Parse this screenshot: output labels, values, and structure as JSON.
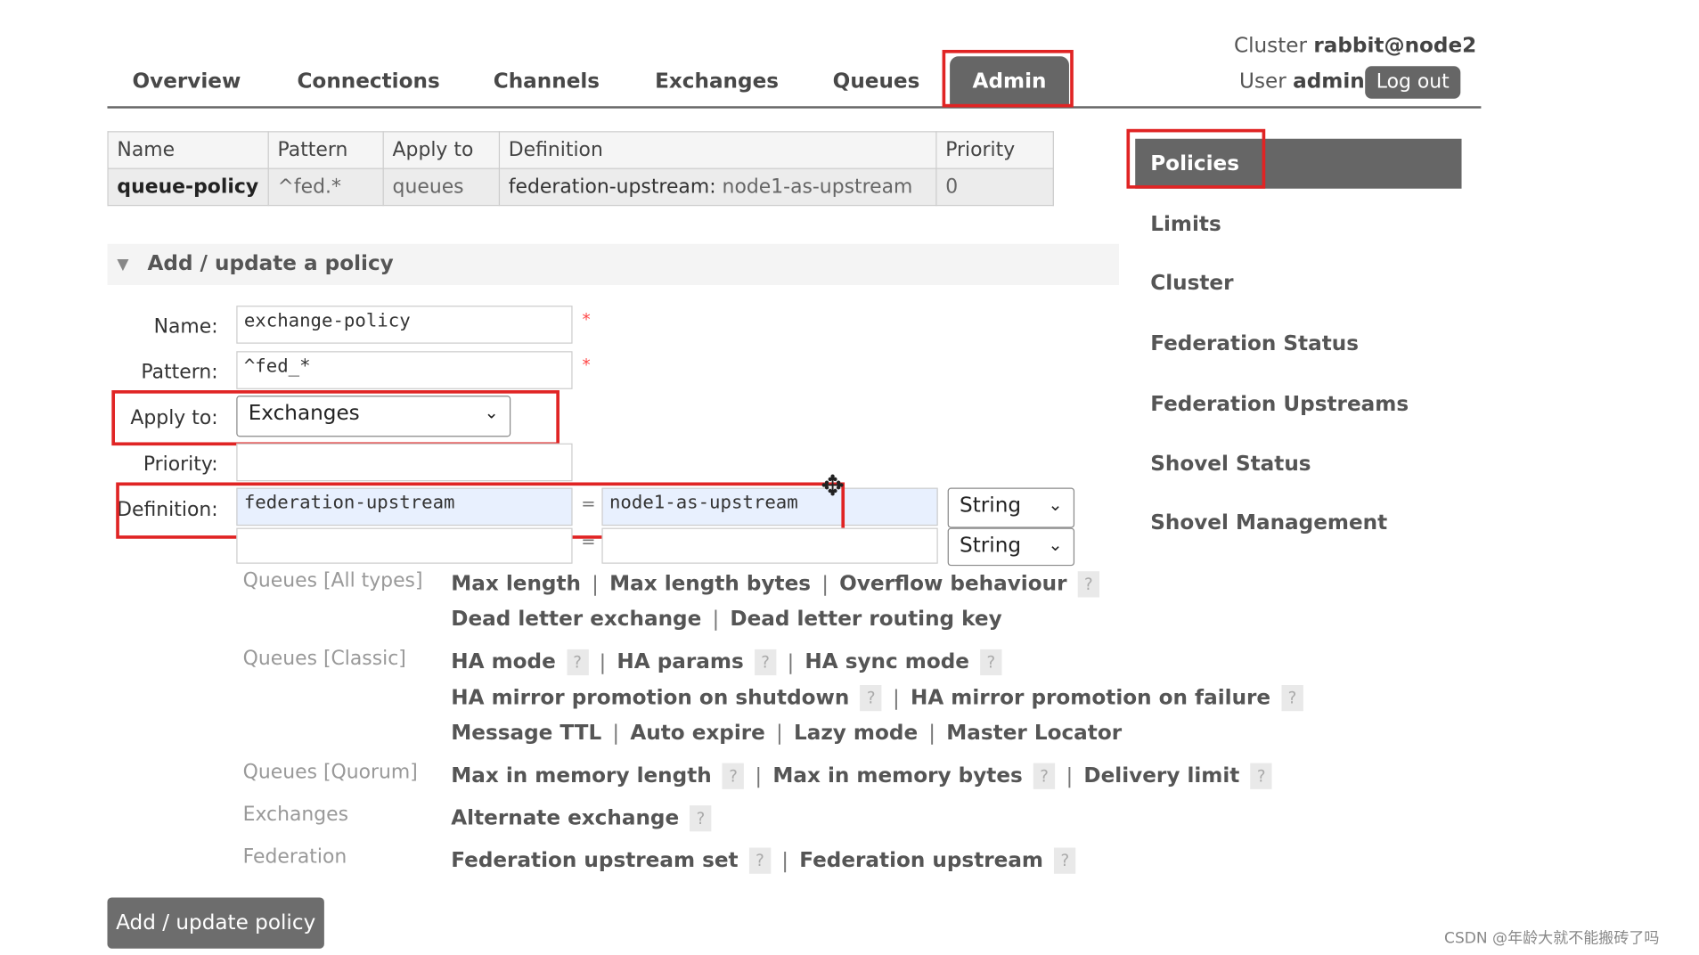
{
  "nav": {
    "tabs": [
      "Overview",
      "Connections",
      "Channels",
      "Exchanges",
      "Queues"
    ],
    "active_tab": "Admin"
  },
  "header": {
    "cluster_label": "Cluster",
    "cluster_name": "rabbit@node2",
    "user_label": "User",
    "user_name": "admin",
    "logout_label": "Log out"
  },
  "policy_table": {
    "columns": [
      "Name",
      "Pattern",
      "Apply to",
      "Definition",
      "Priority"
    ],
    "row": {
      "name": "queue-policy",
      "pattern": "^fed.*",
      "apply_to": "queues",
      "def_key": "federation-upstream:",
      "def_value": "node1-as-upstream",
      "priority": "0"
    }
  },
  "form": {
    "section_title": "Add / update a policy",
    "name_label": "Name:",
    "name_value": "exchange-policy",
    "pattern_label": "Pattern:",
    "pattern_value": "^fed_*",
    "apply_label": "Apply to:",
    "apply_value": "Exchanges",
    "priority_label": "Priority:",
    "definition_label": "Definition:",
    "def_key": "federation-upstream",
    "def_value": "node1-as-upstream",
    "equals": "=",
    "type_1": "String",
    "type_2": "String",
    "required_mark": "*",
    "submit_label": "Add / update policy"
  },
  "help_sections": {
    "queues_all": {
      "label": "Queues [All types]",
      "line1": [
        "Max length",
        "Max length bytes",
        "Overflow behaviour"
      ],
      "line2": [
        "Dead letter exchange",
        "Dead letter routing key"
      ]
    },
    "queues_classic": {
      "label": "Queues [Classic]",
      "line1": [
        "HA mode",
        "HA params",
        "HA sync mode"
      ],
      "line2": [
        "HA mirror promotion on shutdown",
        "HA mirror promotion on failure"
      ],
      "line3": [
        "Message TTL",
        "Auto expire",
        "Lazy mode",
        "Master Locator"
      ]
    },
    "queues_quorum": {
      "label": "Queues [Quorum]",
      "line1": [
        "Max in memory length",
        "Max in memory bytes",
        "Delivery limit"
      ]
    },
    "exchanges": {
      "label": "Exchanges",
      "line1": [
        "Alternate exchange"
      ]
    },
    "federation": {
      "label": "Federation",
      "line1": [
        "Federation upstream set",
        "Federation upstream"
      ]
    },
    "help_mark": "?",
    "separator": "|"
  },
  "sidebar": {
    "items": [
      "Limits",
      "Cluster",
      "Federation Status",
      "Federation Upstreams",
      "Shovel Status",
      "Shovel Management"
    ],
    "active": "Policies"
  },
  "watermark": "CSDN @年龄大就不能搬砖了吗",
  "colors": {
    "tab_active_bg": "#666666",
    "highlight_box": "#e02424",
    "autofill_bg": "#e8f0fe"
  }
}
